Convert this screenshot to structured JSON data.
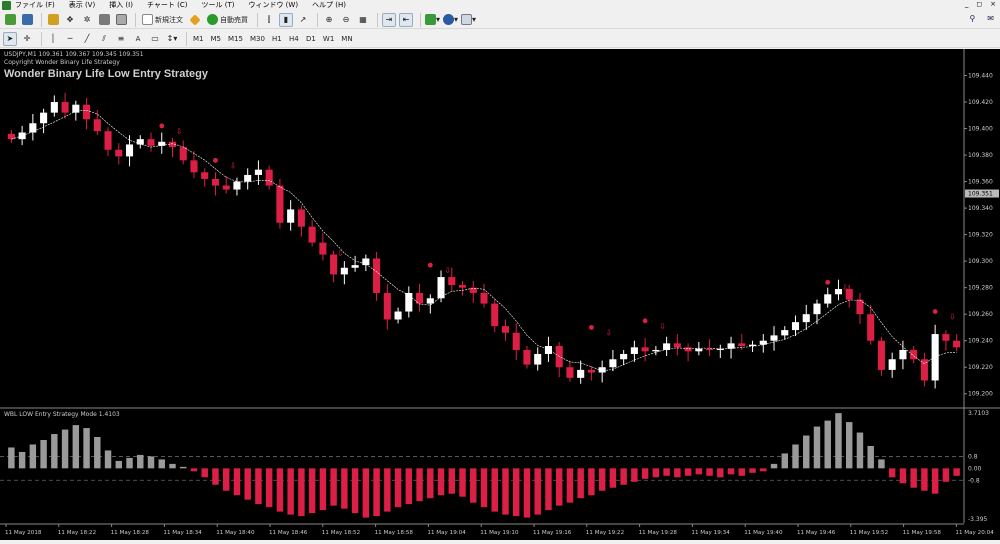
{
  "menu": {
    "items": [
      "ファイル (F)",
      "表示 (V)",
      "挿入 (I)",
      "チャート (C)",
      "ツール (T)",
      "ウィンドウ (W)",
      "ヘルプ (H)"
    ],
    "window_controls": [
      "_",
      "◻",
      "×"
    ]
  },
  "toolbar1": {
    "new_order": "新規注文",
    "auto_trading": "自動売買"
  },
  "toolbar2": {
    "timeframes": [
      "M1",
      "M5",
      "M15",
      "M30",
      "H1",
      "H4",
      "D1",
      "W1",
      "MN"
    ],
    "text_tool": "A"
  },
  "chart": {
    "ohlc_label": "USDJPY,M1  109.361 109.367 109.345 109.351",
    "copyright": "Copyright Wonder Binary Life Strategy",
    "strategy_title": "Wonder Binary Life Low Entry Strategy",
    "indicator_title": "WBL LOW Entry Strategy Mode 1.4103",
    "current_price": "109.351",
    "colors": {
      "bull": "#ffffff",
      "bear": "#dc1f45",
      "ma": "#ffffff",
      "osc_pos": "#9a9a9a",
      "osc_neg": "#dc1f45",
      "grid": "#666666"
    }
  },
  "chart_data": [
    {
      "type": "candlestick",
      "title": "USDJPY,M1",
      "ylim": [
        109.19,
        109.46
      ],
      "y_ticks": [
        "109.440",
        "109.420",
        "109.400",
        "109.380",
        "109.360",
        "109.340",
        "109.320",
        "109.300",
        "109.280",
        "109.260",
        "109.240",
        "109.220",
        "109.200"
      ],
      "x_ticks": [
        "11 May 2018",
        "11 May 18:22",
        "11 May 18:28",
        "11 May 18:34",
        "11 May 18:40",
        "11 May 18:46",
        "11 May 18:52",
        "11 May 18:58",
        "11 May 19:04",
        "11 May 19:10",
        "11 May 19:16",
        "11 May 19:22",
        "11 May 19:28",
        "11 May 19:34",
        "11 May 19:40",
        "11 May 19:46",
        "11 May 19:52",
        "11 May 19:58",
        "11 May 20:04"
      ],
      "close": [
        109.392,
        109.397,
        109.404,
        109.412,
        109.42,
        109.412,
        109.418,
        109.407,
        109.398,
        109.384,
        109.379,
        109.388,
        109.392,
        109.387,
        109.39,
        109.386,
        109.376,
        109.367,
        109.362,
        109.357,
        109.354,
        109.36,
        109.365,
        109.369,
        109.357,
        109.329,
        109.339,
        109.326,
        109.314,
        109.305,
        109.29,
        109.295,
        109.297,
        109.302,
        109.276,
        109.256,
        109.262,
        109.276,
        109.268,
        109.272,
        109.288,
        109.282,
        109.28,
        109.276,
        109.268,
        109.251,
        109.246,
        109.233,
        109.222,
        109.23,
        109.236,
        109.22,
        109.212,
        109.218,
        109.216,
        109.22,
        109.226,
        109.23,
        109.235,
        109.232,
        109.233,
        109.238,
        109.235,
        109.232,
        109.234,
        109.233,
        109.234,
        109.238,
        109.236,
        109.237,
        109.24,
        109.244,
        109.248,
        109.254,
        109.26,
        109.268,
        109.275,
        109.279,
        109.271,
        109.26,
        109.24,
        109.218,
        109.226,
        109.233,
        109.226,
        109.21,
        109.245,
        109.24,
        109.235
      ],
      "markers": [
        {
          "x": "11 May 18:34",
          "kind": "dot",
          "price": 109.402
        },
        {
          "x": "11 May 18:40",
          "kind": "dot",
          "price": 109.376
        },
        {
          "x": "11 May 18:52",
          "kind": "dot",
          "price": 109.31
        },
        {
          "x": "11 May 19:04",
          "kind": "dot",
          "price": 109.297
        },
        {
          "x": "11 May 19:22",
          "kind": "dot",
          "price": 109.25
        },
        {
          "x": "11 May 19:28",
          "kind": "dot",
          "price": 109.255
        },
        {
          "x": "11 May 19:48",
          "kind": "dot",
          "price": 109.284
        },
        {
          "x": "11 May 20:00",
          "kind": "dot",
          "price": 109.262
        }
      ]
    },
    {
      "type": "bar",
      "title": "WBL LOW Entry Strategy Mode 1.4103",
      "ylim": [
        -3.395,
        3.7103
      ],
      "y_ticks": [
        "3.7103",
        "0.8",
        "0.00",
        "-0.8",
        "-3.395"
      ],
      "levels": [
        0.8,
        -0.8
      ],
      "values": [
        1.4,
        1.1,
        1.6,
        1.9,
        2.3,
        2.6,
        2.9,
        2.7,
        2.1,
        1.2,
        0.5,
        0.7,
        0.9,
        0.8,
        0.6,
        0.3,
        0.1,
        -0.2,
        -0.6,
        -1.1,
        -1.5,
        -1.8,
        -2.1,
        -2.4,
        -2.6,
        -2.9,
        -3.1,
        -3.2,
        -3.0,
        -2.8,
        -2.5,
        -2.7,
        -3.0,
        -3.3,
        -3.2,
        -2.9,
        -2.6,
        -2.4,
        -2.2,
        -2.0,
        -1.8,
        -1.7,
        -1.9,
        -2.3,
        -2.6,
        -2.9,
        -3.1,
        -3.2,
        -3.3,
        -3.1,
        -2.8,
        -2.5,
        -2.3,
        -2.0,
        -1.8,
        -1.5,
        -1.3,
        -1.1,
        -0.9,
        -0.7,
        -0.6,
        -0.5,
        -0.6,
        -0.5,
        -0.4,
        -0.5,
        -0.6,
        -0.4,
        -0.5,
        -0.3,
        -0.2,
        0.3,
        1.0,
        1.6,
        2.2,
        2.8,
        3.2,
        3.7,
        3.1,
        2.4,
        1.5,
        0.6,
        -0.6,
        -1.0,
        -1.3,
        -1.5,
        -1.7,
        -0.9,
        -0.5
      ]
    }
  ]
}
